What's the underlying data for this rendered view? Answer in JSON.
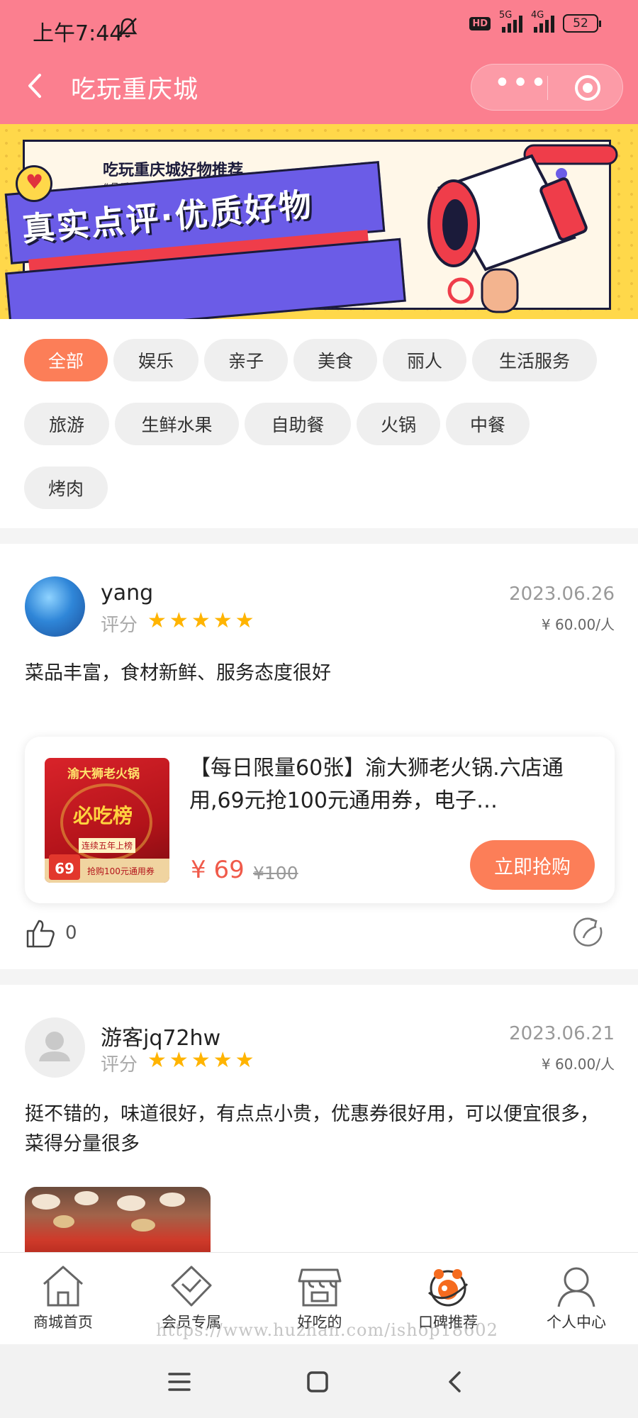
{
  "status_bar": {
    "time": "上午7:44",
    "hd": "HD",
    "net1": "5G",
    "net2": "4G",
    "battery": "52"
  },
  "header": {
    "title": "吃玩重庆城",
    "more_icon": "more-dots-icon",
    "close_icon": "target-icon"
  },
  "banner": {
    "subtitle": "吃玩重庆城好物推荐",
    "slogan": "“品质生活丨一点不难”",
    "headline": "真实点评·优质好物"
  },
  "categories": {
    "row1": [
      "全部",
      "娱乐",
      "亲子",
      "美食",
      "丽人",
      "生活服务"
    ],
    "row2": [
      "旅游",
      "生鲜水果",
      "自助餐",
      "火锅",
      "中餐"
    ],
    "row3": [
      "烤肉"
    ],
    "active": "全部"
  },
  "posts": [
    {
      "user": "yang",
      "score_label": "评分",
      "stars": 5,
      "date": "2023.06.26",
      "price": "¥ 60.00/人",
      "content": "菜品丰富，食材新鲜、服务态度很好",
      "product": {
        "title": "【每日限量60张】渝大狮老火锅.六店通用,69元抢100元通用券，电子…",
        "price": "¥ 69",
        "original_price": "¥100",
        "buy_label": "立即抢购",
        "image_brand": "渝大狮老火锅",
        "image_badge": "必吃榜",
        "image_tag": "连续五年上榜",
        "image_price": "69",
        "image_footer": "抢购100元通用券"
      },
      "likes": "0"
    },
    {
      "user": "游客jq72hw",
      "score_label": "评分",
      "stars": 5,
      "date": "2023.06.21",
      "price": "¥ 60.00/人",
      "content": "挺不错的，味道很好，有点点小贵，优惠券很好用，可以便宜很多，菜得分量很多"
    }
  ],
  "tabbar": {
    "items": [
      {
        "label": "商城首页",
        "icon": "home-icon"
      },
      {
        "label": "会员专属",
        "icon": "vip-diamond-icon"
      },
      {
        "label": "好吃的",
        "icon": "shop-icon"
      },
      {
        "label": "口碑推荐",
        "icon": "reputation-icon"
      },
      {
        "label": "个人中心",
        "icon": "user-icon"
      }
    ],
    "watermark": "https://www.huzhan.com/ishop18602"
  },
  "colors": {
    "header": "#fb7f8f",
    "accent": "#fc7e58",
    "star": "#ffb400",
    "price": "#f05a4a"
  }
}
